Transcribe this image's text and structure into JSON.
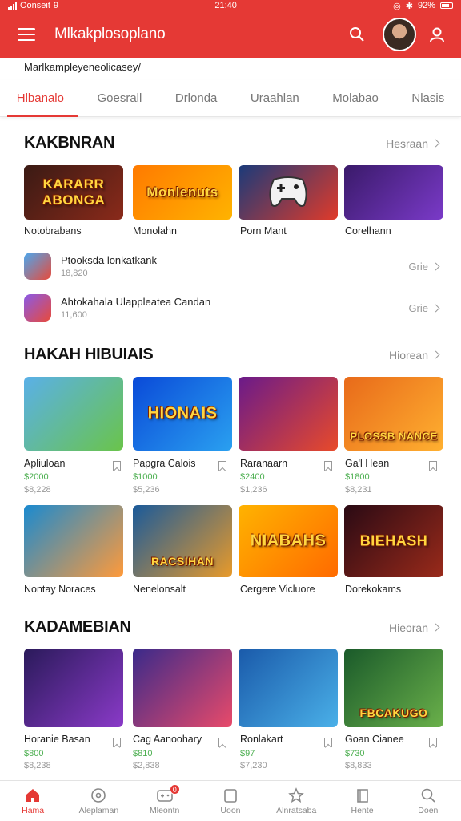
{
  "status_bar": {
    "carrier": "Oonseit",
    "carrier_symbol": "9",
    "time": "21:40",
    "battery": "92%"
  },
  "app_bar": {
    "title": "Mlkakplosoplano"
  },
  "subtitle": "Marlkampleyeneolicasey/",
  "tabs": [
    {
      "label": "Hlbanalo",
      "active": true
    },
    {
      "label": "Goesrall"
    },
    {
      "label": "Drlonda"
    },
    {
      "label": "Uraahlan"
    },
    {
      "label": "Molabao"
    },
    {
      "label": "Nlasis"
    }
  ],
  "section1": {
    "title": "KAKBNRAN",
    "see_more": "Hesraan",
    "tiles": [
      {
        "name": "Notobrabans",
        "art": "KARARR ABONGA",
        "colors": [
          "#3a1a14",
          "#8a2a1a"
        ]
      },
      {
        "name": "Monolahn",
        "art": "Monlenuts",
        "colors": [
          "#ff7a00",
          "#ffb300"
        ]
      },
      {
        "name": "Porn Mant",
        "art": "",
        "colors": [
          "#1a3a7a",
          "#e03a2a"
        ]
      },
      {
        "name": "Corelhann",
        "art": "",
        "colors": [
          "#3a1a6a",
          "#7a3ac8"
        ]
      }
    ],
    "list": [
      {
        "title": "Ptooksda lonkatkank",
        "count": "18,820",
        "action": "Grie"
      },
      {
        "title": "Ahtokahala Ulappleatea Candan",
        "count": "11,600",
        "action": "Grie"
      }
    ]
  },
  "section2": {
    "title": "HAKAH HIBUIAIS",
    "see_more": "Hiorean",
    "tiles": [
      {
        "name": "Apliuloan",
        "price": "$2000",
        "count": "$8,228",
        "art": "",
        "colors": [
          "#5ab0e8",
          "#6ac44a"
        ]
      },
      {
        "name": "Papgra Calois",
        "price": "$1000",
        "count": "$5,236",
        "art": "HIONAIS",
        "colors": [
          "#0a4ad8",
          "#2aa0f0"
        ]
      },
      {
        "name": "Raranaarn",
        "price": "$2400",
        "count": "$1,236",
        "art": "",
        "colors": [
          "#6a1a8a",
          "#e84a2a"
        ]
      },
      {
        "name": "Ga'l Hean",
        "price": "$1800",
        "count": "$8,231",
        "art": "PLOSSB NANCE",
        "colors": [
          "#e86a1a",
          "#ffb030"
        ]
      },
      {
        "name": "Nontay Noraces",
        "price": "",
        "count": "",
        "art": "",
        "colors": [
          "#1a8ad0",
          "#ff9a3a"
        ]
      },
      {
        "name": "Nenelonsalt",
        "price": "",
        "count": "",
        "art": "RACSIHAN",
        "colors": [
          "#1a5a9a",
          "#e89a2a"
        ]
      },
      {
        "name": "Cergere Vicluore",
        "price": "",
        "count": "",
        "art": "NIABAHS",
        "colors": [
          "#ffb300",
          "#ff6a00"
        ]
      },
      {
        "name": "Dorekokams",
        "price": "",
        "count": "",
        "art": "BIEHASH",
        "colors": [
          "#2a0a14",
          "#9a2a1a"
        ]
      }
    ]
  },
  "section3": {
    "title": "KADAMEBIAN",
    "see_more": "Hieoran",
    "tiles": [
      {
        "name": "Horanie Basan",
        "price": "$800",
        "count": "$8,238",
        "art": "",
        "colors": [
          "#2a1a5a",
          "#8a3ac8"
        ]
      },
      {
        "name": "Cag Aanoohary",
        "price": "$810",
        "count": "$2,838",
        "art": "",
        "colors": [
          "#3a2a8a",
          "#e84a6a"
        ]
      },
      {
        "name": "Ronlakart",
        "price": "$97",
        "count": "$7,230",
        "art": "",
        "colors": [
          "#1a5aaa",
          "#4ab0e8"
        ]
      },
      {
        "name": "Goan Cianee",
        "price": "$730",
        "count": "$8,833",
        "art": "FBCAKUGO",
        "colors": [
          "#1a5a2a",
          "#6ab04a"
        ]
      }
    ]
  },
  "bottom_nav": [
    {
      "label": "Hama",
      "icon": "home-icon",
      "active": true
    },
    {
      "label": "Aleplaman",
      "icon": "compass-icon"
    },
    {
      "label": "Mleontn",
      "icon": "gamepad-icon",
      "badge": "0"
    },
    {
      "label": "Uoon",
      "icon": "tablet-icon"
    },
    {
      "label": "Alnratsaba",
      "icon": "star-icon"
    },
    {
      "label": "Hente",
      "icon": "book-icon"
    },
    {
      "label": "Doen",
      "icon": "search-icon"
    }
  ],
  "colors": {
    "primary": "#e53935",
    "price": "#4caf50",
    "muted": "#999999"
  }
}
